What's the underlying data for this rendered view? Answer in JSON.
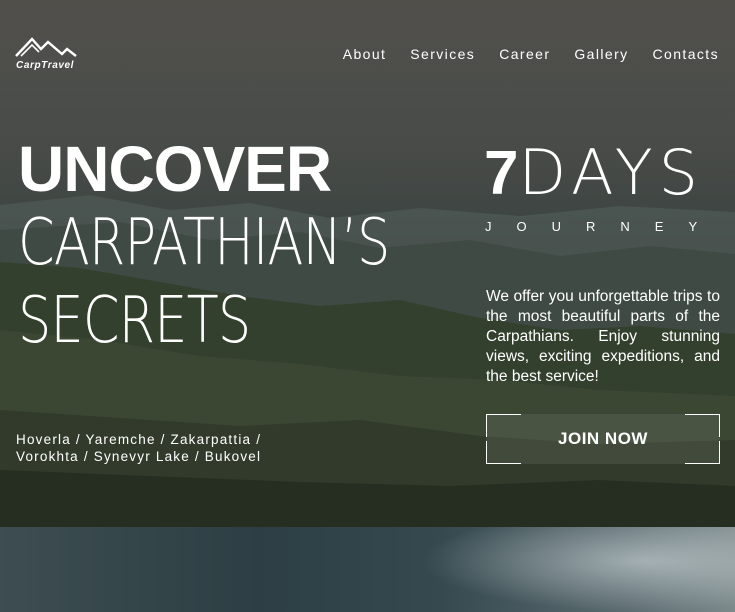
{
  "brand": {
    "name": "CarpTravel",
    "icon": "mountains-logo-icon"
  },
  "nav": {
    "items": [
      {
        "label": "About"
      },
      {
        "label": "Services"
      },
      {
        "label": "Career"
      },
      {
        "label": "Gallery"
      },
      {
        "label": "Contacts"
      }
    ]
  },
  "hero": {
    "title_line1": "UNCOVER",
    "title_line2": "CARPATHIAN’S",
    "title_line3": "SECRETS",
    "places_line1": "Hoverla / Yaremche / Zakarpattia /",
    "places_line2": "Vorokhta / Synevyr Lake / Bukovel",
    "days_number": "7",
    "days_word": "DAYS",
    "journey": "JOURNEY",
    "description": "We offer you unforgettable trips to the most beautiful parts of the Carpathians. Enjoy stunning views, exciting expeditions, and the best service!",
    "cta_label": "JOIN NOW"
  }
}
